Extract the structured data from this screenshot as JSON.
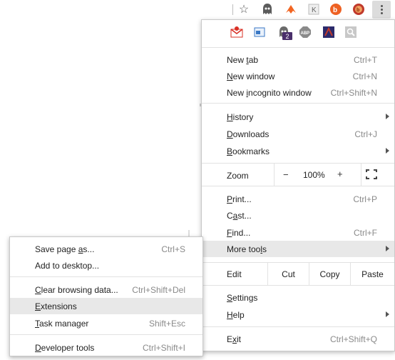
{
  "toolbar": {
    "star_icon": "star-icon",
    "extensions": [
      "ghostery-icon",
      "fox-icon",
      "k-icon",
      "bitly-icon",
      "blog-icon"
    ],
    "menu_icon": "kebab-menu-icon"
  },
  "extension_row": {
    "icons": [
      "gmail-checker-icon",
      "screenshot-icon",
      "ghost-icon",
      "adblock-plus-icon",
      "night-icon",
      "search-plugin-icon"
    ],
    "ghost_badge": "2"
  },
  "menu": {
    "new_tab": {
      "label_prefix": "New ",
      "label_accel": "t",
      "label_suffix": "ab",
      "shortcut": "Ctrl+T"
    },
    "new_window": {
      "label_prefix": "",
      "label_accel": "N",
      "label_suffix": "ew window",
      "shortcut": "Ctrl+N"
    },
    "new_incognito": {
      "label_prefix": "New ",
      "label_accel": "i",
      "label_suffix": "ncognito window",
      "shortcut": "Ctrl+Shift+N"
    },
    "history": {
      "label_prefix": "",
      "label_accel": "H",
      "label_suffix": "istory"
    },
    "downloads": {
      "label_prefix": "",
      "label_accel": "D",
      "label_suffix": "ownloads",
      "shortcut": "Ctrl+J"
    },
    "bookmarks": {
      "label_prefix": "",
      "label_accel": "B",
      "label_suffix": "ookmarks"
    },
    "zoom": {
      "label": "Zoom",
      "minus": "−",
      "value": "100%",
      "plus": "+"
    },
    "print": {
      "label_prefix": "",
      "label_accel": "P",
      "label_suffix": "rint...",
      "shortcut": "Ctrl+P"
    },
    "cast": {
      "label_prefix": "C",
      "label_accel": "a",
      "label_suffix": "st..."
    },
    "find": {
      "label_prefix": "",
      "label_accel": "F",
      "label_suffix": "ind...",
      "shortcut": "Ctrl+F"
    },
    "more_tools": {
      "label_prefix": "More too",
      "label_accel": "l",
      "label_suffix": "s"
    },
    "edit": {
      "label": "Edit",
      "cut": "Cut",
      "copy": "Copy",
      "paste": "Paste"
    },
    "settings": {
      "label_prefix": "",
      "label_accel": "S",
      "label_suffix": "ettings"
    },
    "help": {
      "label_prefix": "",
      "label_accel": "H",
      "label_suffix": "elp"
    },
    "exit": {
      "label_prefix": "E",
      "label_accel": "x",
      "label_suffix": "it",
      "shortcut": "Ctrl+Shift+Q"
    }
  },
  "submenu": {
    "save_page": {
      "label_prefix": "Save page ",
      "label_accel": "a",
      "label_suffix": "s...",
      "shortcut": "Ctrl+S"
    },
    "add_desktop": {
      "label": "Add to desktop..."
    },
    "clear_data": {
      "label_prefix": "",
      "label_accel": "C",
      "label_suffix": "lear browsing data...",
      "shortcut": "Ctrl+Shift+Del"
    },
    "extensions": {
      "label_prefix": "",
      "label_accel": "E",
      "label_suffix": "xtensions"
    },
    "task_manager": {
      "label_prefix": "",
      "label_accel": "T",
      "label_suffix": "ask manager",
      "shortcut": "Shift+Esc"
    },
    "dev_tools": {
      "label_prefix": "",
      "label_accel": "D",
      "label_suffix": "eveloper tools",
      "shortcut": "Ctrl+Shift+I"
    }
  },
  "colors": {
    "highlight": "#e8e8e8",
    "gmail_red": "#d93025",
    "abp_gray": "#8a8a8a",
    "bitly_orange": "#ee6123",
    "fox_orange": "#f26522"
  }
}
